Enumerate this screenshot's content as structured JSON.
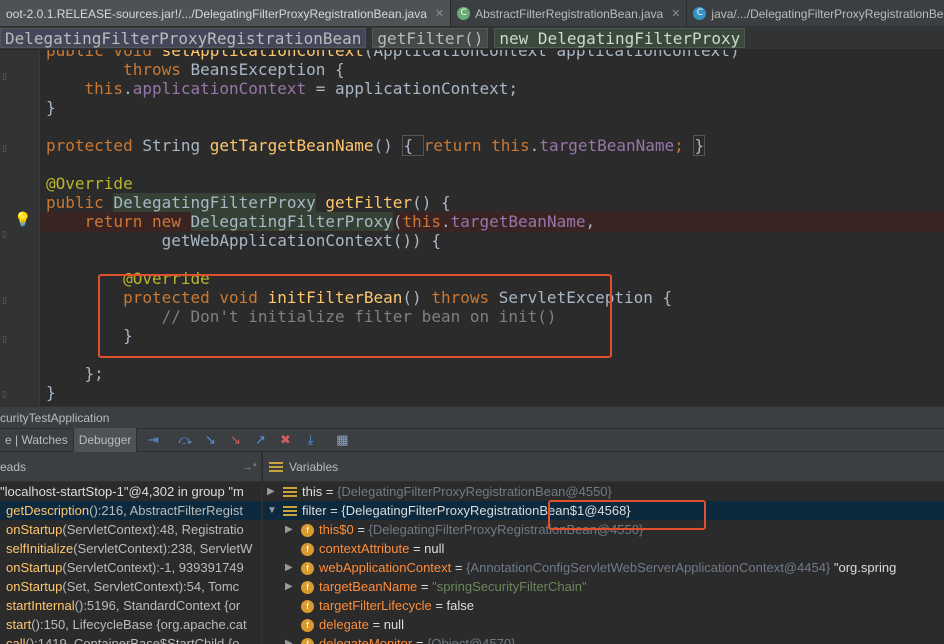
{
  "tabs": [
    {
      "label": "oot-2.0.1.RELEASE-sources.jar!/.../DelegatingFilterProxyRegistrationBean.java",
      "active": true,
      "icon": "none"
    },
    {
      "label": "AbstractFilterRegistrationBean.java",
      "active": false,
      "icon": "class-lib-icon"
    },
    {
      "label": "java/.../DelegatingFilterProxyRegistrationBean.java",
      "active": false,
      "icon": "class-icon"
    }
  ],
  "breadcrumb": {
    "items": [
      "DelegatingFilterProxyRegistrationBean",
      "getFilter()",
      "new DelegatingFilterProxy"
    ]
  },
  "code": {
    "l1a": "public void ",
    "l1b": "setApplicationContext",
    "l1c": "(ApplicationContext applicationContext)",
    "l2a": "        throws ",
    "l2b": "BeansException {",
    "l3a": "    ",
    "l3b": "this",
    "l3c": ".",
    "l3d": "applicationContext",
    "l3e": " = applicationContext;",
    "l4": "}",
    "l6a": "protected ",
    "l6b": "String ",
    "l6c": "getTargetBeanName",
    "l6d": "() ",
    "l6e": "{ ",
    "l6f": "return ",
    "l6g": "this",
    "l6h": ".",
    "l6i": "targetBeanName",
    "l6j": "; ",
    "l6k": "}",
    "l8": "@Override",
    "l9a": "public ",
    "l9b": "DelegatingFilterProxy",
    "l9c": " ",
    "l9d": "getFilter",
    "l9e": "() {",
    "l10a": "    return new ",
    "l10b": "DelegatingFilterProxy",
    "l10c": "(",
    "l10d": "this",
    "l10e": ".",
    "l10f": "targetBeanName",
    "l10g": ",",
    "l11": "            getWebApplicationContext()) {",
    "l13": "        @Override",
    "l14a": "        protected void ",
    "l14b": "initFilterBean",
    "l14c": "() ",
    "l14d": "throws ",
    "l14e": "ServletException {",
    "l15": "            // Don't initialize filter bean on init()",
    "l16": "        }",
    "l18": "    };",
    "l19": "}"
  },
  "run_config": "curityTestApplication",
  "debug_toolbar": {
    "tabs": [
      "e | Watches",
      "Debugger"
    ],
    "icons": [
      "show-execution-point-icon",
      "step-over-icon",
      "step-into-icon",
      "force-step-into-icon",
      "step-out-icon",
      "drop-frame-icon",
      "run-to-cursor-icon",
      "evaluate-icon"
    ]
  },
  "frames_panel": {
    "title": "eads",
    "pin": "→*",
    "thread": "\"localhost-startStop-1\"@4,302 in group \"m",
    "frames": [
      {
        "method": "getDescription",
        "rest": "():216, AbstractFilterRegist"
      },
      {
        "method": "onStartup",
        "rest": "(ServletContext):48, Registratio"
      },
      {
        "method": "selfInitialize",
        "rest": "(ServletContext):238, ServletW"
      },
      {
        "method": "onStartup",
        "rest": "(ServletContext):-1, 939391749"
      },
      {
        "method": "onStartup",
        "rest": "(Set, ServletContext):54, Tomc"
      },
      {
        "method": "startInternal",
        "rest": "():5196, StandardContext {or"
      },
      {
        "method": "start",
        "rest": "():150, LifecycleBase {org.apache.cat"
      },
      {
        "method": "call",
        "rest": "():1419, ContainerBase$StartChild {o"
      }
    ]
  },
  "variables_panel": {
    "title": "Variables",
    "rows": [
      {
        "name": "this",
        "value": "{DelegatingFilterProxyRegistrationBean@4550}",
        "kind": "eq",
        "expand": true,
        "indent": 0,
        "extra": ""
      },
      {
        "name": "filter",
        "value": "{DelegatingFilterProxyRegistrationBean$1@4568}",
        "kind": "eq",
        "expand": true,
        "open": true,
        "indent": 0,
        "extra": ""
      },
      {
        "name": "this$0",
        "value": "{DelegatingFilterProxyRegistrationBean@4550}",
        "kind": "field",
        "expand": true,
        "indent": 1,
        "extra": ""
      },
      {
        "name": "contextAttribute",
        "value": "null",
        "kind": "field",
        "expand": false,
        "indent": 1,
        "extra": ""
      },
      {
        "name": "webApplicationContext",
        "value": "{AnnotationConfigServletWebServerApplicationContext@4454}",
        "kind": "field",
        "expand": true,
        "indent": 1,
        "extra": " \"org.spring"
      },
      {
        "name": "targetBeanName",
        "value": "\"springSecurityFilterChain\"",
        "kind": "field",
        "expand": true,
        "indent": 1,
        "extra": ""
      },
      {
        "name": "targetFilterLifecycle",
        "value": "false",
        "kind": "field",
        "expand": false,
        "indent": 1,
        "extra": ""
      },
      {
        "name": "delegate",
        "value": "null",
        "kind": "field",
        "expand": false,
        "indent": 1,
        "extra": ""
      },
      {
        "name": "delegateMonitor",
        "value": "{Object@4570}",
        "kind": "field",
        "expand": true,
        "indent": 1,
        "extra": ""
      }
    ]
  },
  "colors": {
    "keyword": "#cc7832",
    "method": "#ffc66d",
    "field": "#9876aa",
    "annotation": "#bbb529",
    "highlight_box": "#e0502c"
  }
}
